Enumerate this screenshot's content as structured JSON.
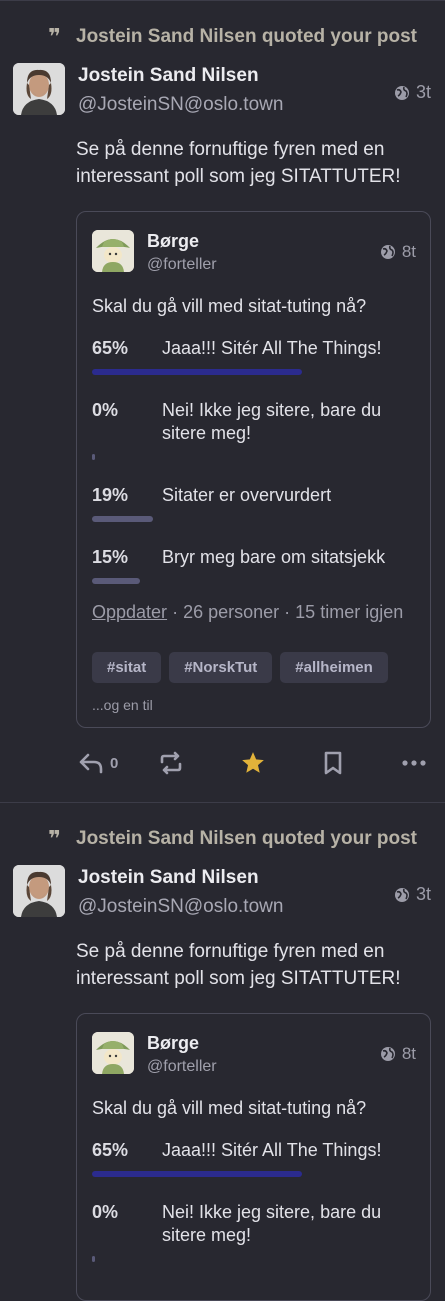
{
  "notifications": [
    {
      "label": "Jostein Sand Nilsen quoted your post",
      "author": {
        "name": "Jostein Sand Nilsen",
        "handle": "@JosteinSN@oslo.town",
        "time": "3t"
      },
      "text": "Se på denne fornuftige fyren med en interessant poll som jeg SITATTUTER!",
      "quote": {
        "author": {
          "name": "Børge",
          "handle": "@forteller",
          "time": "8t"
        },
        "text": "Skal du gå vill med sitat-tuting nå?",
        "poll": [
          {
            "percent": "65%",
            "label": "Jaaa!!! Sitér All The Things!",
            "value": 65,
            "leading": true
          },
          {
            "percent": "0%",
            "label": "Nei! Ikke jeg sitere, bare du sitere meg!",
            "value": 0,
            "leading": false
          },
          {
            "percent": "19%",
            "label": "Sitater er overvurdert",
            "value": 19,
            "leading": false
          },
          {
            "percent": "15%",
            "label": "Bryr meg bare om sitatsjekk",
            "value": 15,
            "leading": false
          }
        ],
        "poll_refresh": "Oppdater",
        "poll_voters": "26 personer",
        "poll_remaining": "15 timer igjen",
        "tags": [
          "#sitat",
          "#NorskTut",
          "#allheimen"
        ],
        "more": "...og en til"
      },
      "actions": {
        "reply_count": "0",
        "favourited": true
      }
    },
    {
      "label": "Jostein Sand Nilsen quoted your post",
      "author": {
        "name": "Jostein Sand Nilsen",
        "handle": "@JosteinSN@oslo.town",
        "time": "3t"
      },
      "text": "Se på denne fornuftige fyren med en interessant poll som jeg SITATTUTER!",
      "quote": {
        "author": {
          "name": "Børge",
          "handle": "@forteller",
          "time": "8t"
        },
        "text": "Skal du gå vill med sitat-tuting nå?",
        "poll": [
          {
            "percent": "65%",
            "label": "Jaaa!!! Sitér All The Things!",
            "value": 65,
            "leading": true
          },
          {
            "percent": "0%",
            "label": "Nei! Ikke jeg sitere, bare du sitere meg!",
            "value": 0,
            "leading": false
          }
        ]
      }
    }
  ],
  "colors": {
    "background": "#282830",
    "favourite": "#e2b33a",
    "poll_leading": "#2b2b8e",
    "poll_other": "#5a5a78"
  },
  "icons": [
    "quote-icon",
    "globe-icon",
    "reply-icon",
    "boost-icon",
    "star-icon",
    "bookmark-icon",
    "more-icon"
  ]
}
